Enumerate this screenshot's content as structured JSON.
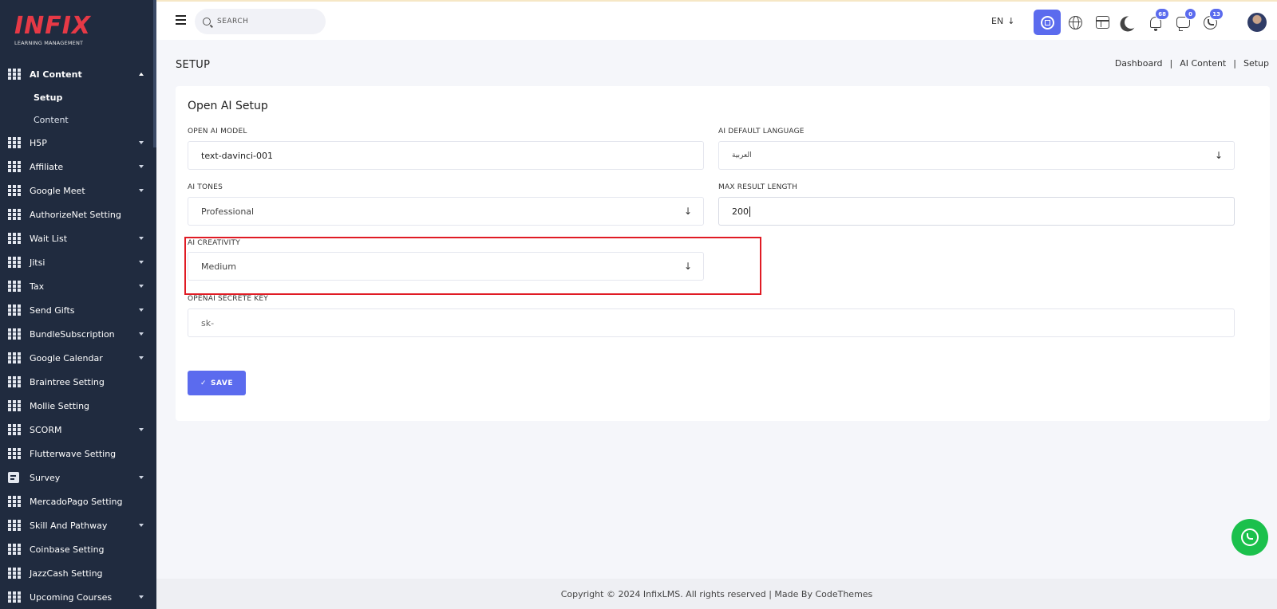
{
  "brand": {
    "name": "INFIX",
    "subtitle": "LEARNING MANAGEMENT"
  },
  "sidebar": {
    "items": [
      {
        "label": "AI Content",
        "icon": "grid-icon",
        "expanded": true
      },
      {
        "label": "H5P",
        "icon": "grid-icon",
        "has_caret": true
      },
      {
        "label": "Affiliate",
        "icon": "grid-icon",
        "has_caret": true
      },
      {
        "label": "Google Meet",
        "icon": "grid-icon",
        "has_caret": true
      },
      {
        "label": "AuthorizeNet Setting",
        "icon": "grid-icon",
        "has_caret": false
      },
      {
        "label": "Wait List",
        "icon": "grid-icon",
        "has_caret": true
      },
      {
        "label": "Jitsi",
        "icon": "grid-icon",
        "has_caret": true
      },
      {
        "label": "Tax",
        "icon": "grid-icon",
        "has_caret": true
      },
      {
        "label": "Send Gifts",
        "icon": "grid-icon",
        "has_caret": true
      },
      {
        "label": "BundleSubscription",
        "icon": "grid-icon",
        "has_caret": true
      },
      {
        "label": "Google Calendar",
        "icon": "grid-icon",
        "has_caret": true
      },
      {
        "label": "Braintree Setting",
        "icon": "grid-icon",
        "has_caret": false
      },
      {
        "label": "Mollie Setting",
        "icon": "grid-icon",
        "has_caret": false
      },
      {
        "label": "SCORM",
        "icon": "grid-icon",
        "has_caret": true
      },
      {
        "label": "Flutterwave Setting",
        "icon": "grid-icon",
        "has_caret": false
      },
      {
        "label": "Survey",
        "icon": "document-icon",
        "has_caret": true
      },
      {
        "label": "MercadoPago Setting",
        "icon": "grid-icon",
        "has_caret": false
      },
      {
        "label": "Skill And Pathway",
        "icon": "grid-icon",
        "has_caret": true
      },
      {
        "label": "Coinbase Setting",
        "icon": "grid-icon",
        "has_caret": false
      },
      {
        "label": "JazzCash Setting",
        "icon": "grid-icon",
        "has_caret": false
      },
      {
        "label": "Upcoming Courses",
        "icon": "grid-icon",
        "has_caret": true
      }
    ],
    "submenu": [
      {
        "label": "Setup",
        "current": true
      },
      {
        "label": "Content",
        "current": false
      }
    ]
  },
  "topbar": {
    "search_placeholder": "SEARCH",
    "language": "EN",
    "language_arrow": "↓",
    "notifications_count": "68",
    "messages_count": "0",
    "calls_count": "13",
    "icons": [
      "menu-icon",
      "search-icon",
      "chip-icon",
      "globe-icon",
      "layout-icon",
      "moon-icon",
      "bell-icon",
      "chat-icon",
      "phone-icon",
      "avatar"
    ]
  },
  "page": {
    "title": "SETUP",
    "breadcrumb": [
      "Dashboard",
      "AI Content",
      "Setup"
    ],
    "breadcrumb_separator": "|"
  },
  "form": {
    "title": "Open AI Setup",
    "model_label": "OPEN AI MODEL",
    "model_value": "text-davinci-001",
    "language_label": "AI DEFAULT LANGUAGE",
    "language_value": "العربية",
    "tones_label": "AI TONES",
    "tones_value": "Professional",
    "max_length_label": "MAX RESULT LENGTH",
    "max_length_value": "200",
    "creativity_label": "AI CREATIVITY",
    "creativity_value": "Medium",
    "key_label": "OPENAI SECRETE KEY",
    "key_value": "sk-",
    "select_arrow": "↓",
    "save_label": "SAVE",
    "save_check": "✓"
  },
  "footer": {
    "text": "Copyright © 2024 InfixLMS. All rights reserved | Made By CodeThemes"
  },
  "colors": {
    "sidebar_bg": "#202b3f",
    "accent": "#5b6bee",
    "highlight": "#e01b24",
    "whatsapp": "#1bc04c"
  }
}
